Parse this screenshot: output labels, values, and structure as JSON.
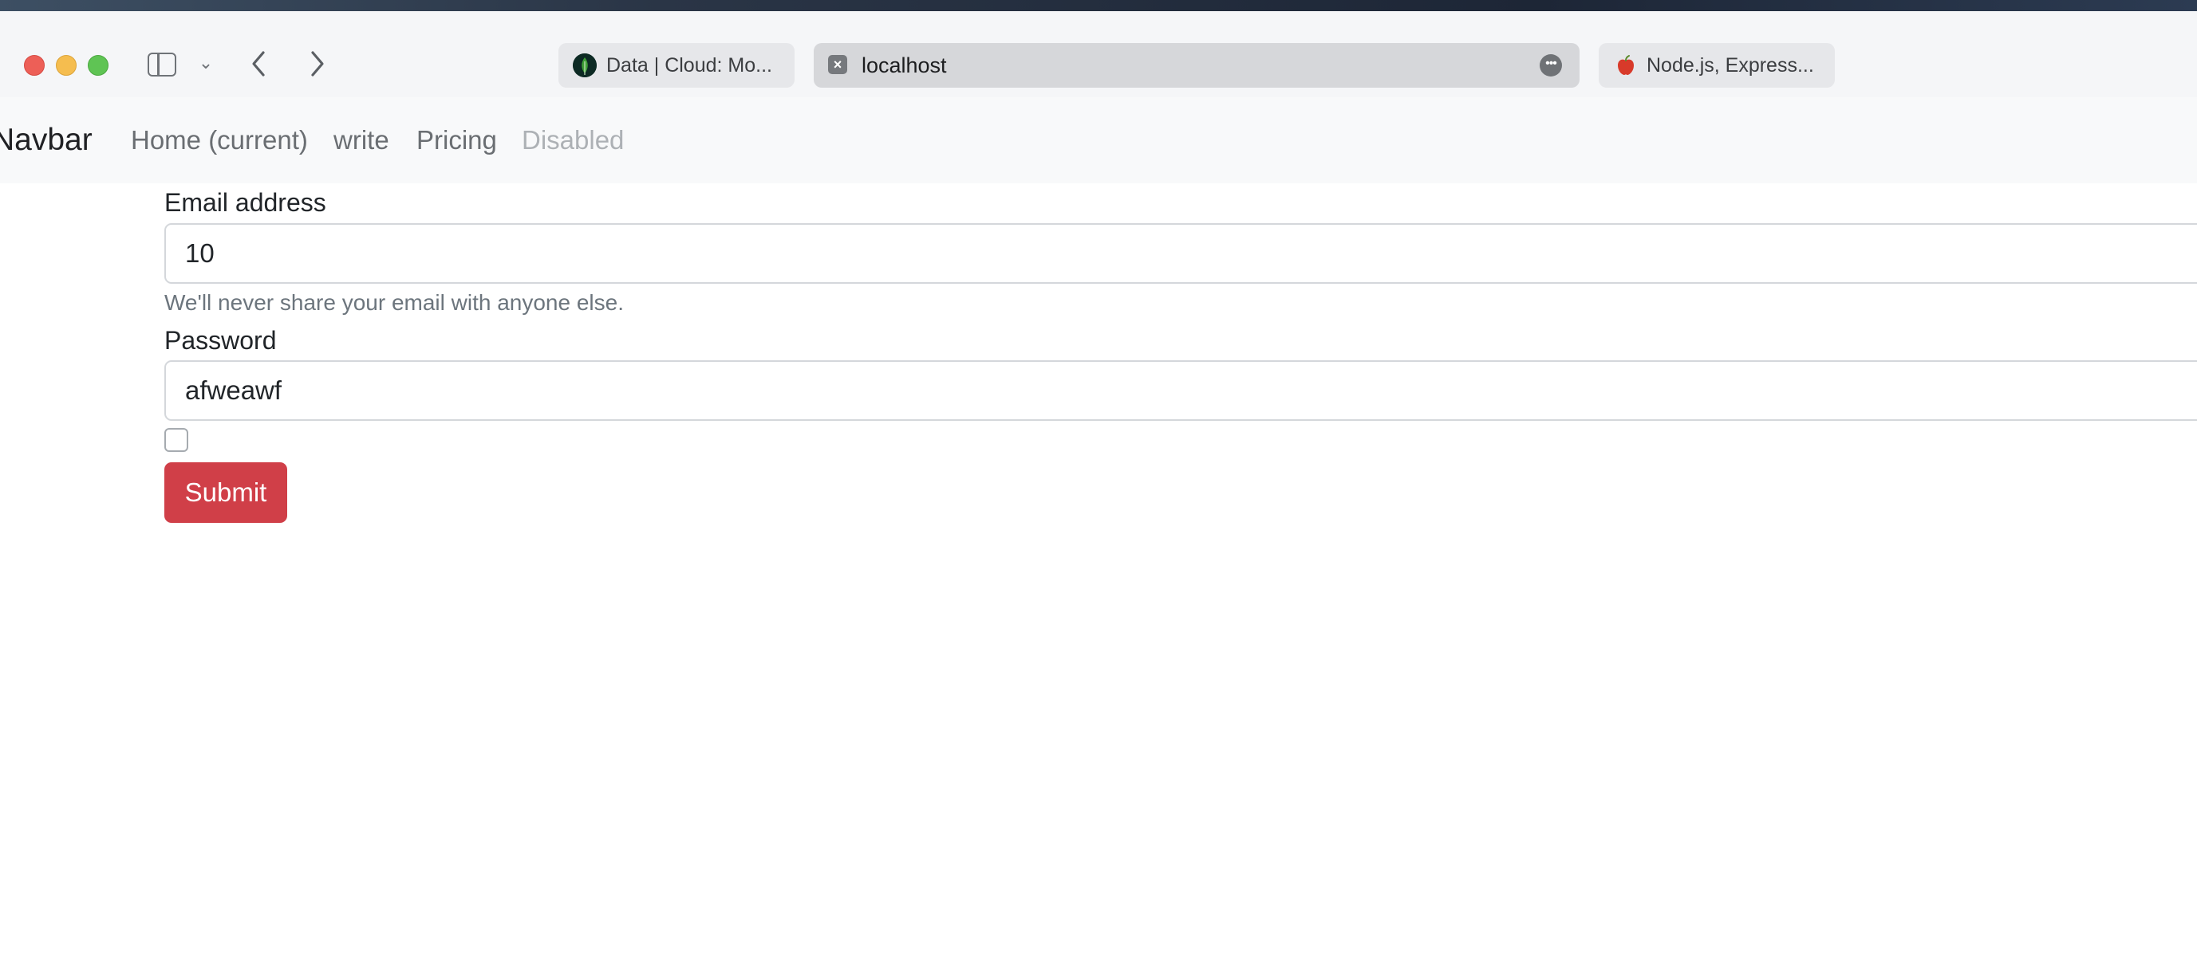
{
  "browser": {
    "tabs": [
      {
        "label": "Data | Cloud: Mo...",
        "favicon": "mongodb-leaf-icon"
      },
      {
        "label": "localhost",
        "favicon": "close-tab-icon",
        "active": true
      },
      {
        "label": "Node.js, Express...",
        "favicon": "apple-icon"
      }
    ]
  },
  "navbar": {
    "brand": "Navbar",
    "links": [
      {
        "label": "Home (current)"
      },
      {
        "label": "write"
      },
      {
        "label": "Pricing"
      },
      {
        "label": "Disabled",
        "disabled": true
      }
    ]
  },
  "form": {
    "email_label": "Email address",
    "email_value": "10",
    "email_help": "We'll never share your email with anyone else.",
    "password_label": "Password",
    "password_value": "afweawf",
    "checkbox_checked": false,
    "submit_label": "Submit"
  },
  "colors": {
    "submit_bg": "#d03f48",
    "navbar_bg": "#f8f9fa",
    "disabled_link": "#adb1b5"
  }
}
